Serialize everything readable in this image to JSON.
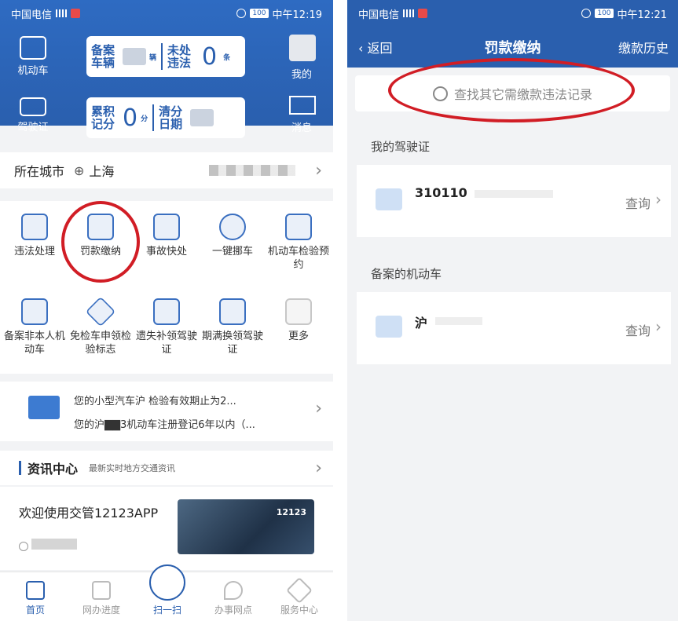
{
  "left": {
    "status": {
      "carrier": "中国电信",
      "battery": "100",
      "time": "中午12:19"
    },
    "header": {
      "vehicle_label": "机动车",
      "license_label": "驾驶证",
      "mine_label": "我的",
      "message_label": "消息",
      "card1": {
        "left_text_1": "备案",
        "left_text_2": "车辆",
        "left_unit": "辆",
        "right_text_1": "未处",
        "right_text_2": "违法",
        "value": "0",
        "unit": "条"
      },
      "card2": {
        "left_text_1": "累积",
        "left_text_2": "记分",
        "value": "0",
        "unit": "分",
        "right_text_1": "清分",
        "right_text_2": "日期"
      }
    },
    "city": {
      "label": "所在城市",
      "value": "上海"
    },
    "grid": [
      {
        "label": "违法处理"
      },
      {
        "label": "罚款缴纳"
      },
      {
        "label": "事故快处"
      },
      {
        "label": "一键挪车"
      },
      {
        "label": "机动车检验预约"
      },
      {
        "label": "备案非本人机动车"
      },
      {
        "label": "免检车申领检验标志"
      },
      {
        "label": "遗失补领驾驶证"
      },
      {
        "label": "期满换领驾驶证"
      },
      {
        "label": "更多"
      }
    ],
    "notices": [
      "您的小型汽车沪      检验有效期止为2...",
      "您的沪▇▇3机动车注册登记6年以内（..."
    ],
    "news": {
      "title": "资讯中心",
      "subtitle": "最新实时地方交通资讯",
      "card_title": "欢迎使用交管12123APP",
      "thumb_text": "12123"
    },
    "tabs": [
      "首页",
      "网办进度",
      "扫一扫",
      "办事网点",
      "服务中心"
    ],
    "accent_color": "#2a5fae",
    "highlight_color": "#d11d25"
  },
  "right": {
    "status": {
      "carrier": "中国电信",
      "battery": "100",
      "time": "中午12:21"
    },
    "nav": {
      "back": "返回",
      "title": "罚款缴纳",
      "history": "缴款历史"
    },
    "search": {
      "placeholder": "查找其它需缴款违法记录"
    },
    "license_section": {
      "label": "我的驾驶证",
      "number": "310110",
      "action": "查询"
    },
    "vehicle_section": {
      "label": "备案的机动车",
      "plate": "沪",
      "action": "查询"
    }
  }
}
